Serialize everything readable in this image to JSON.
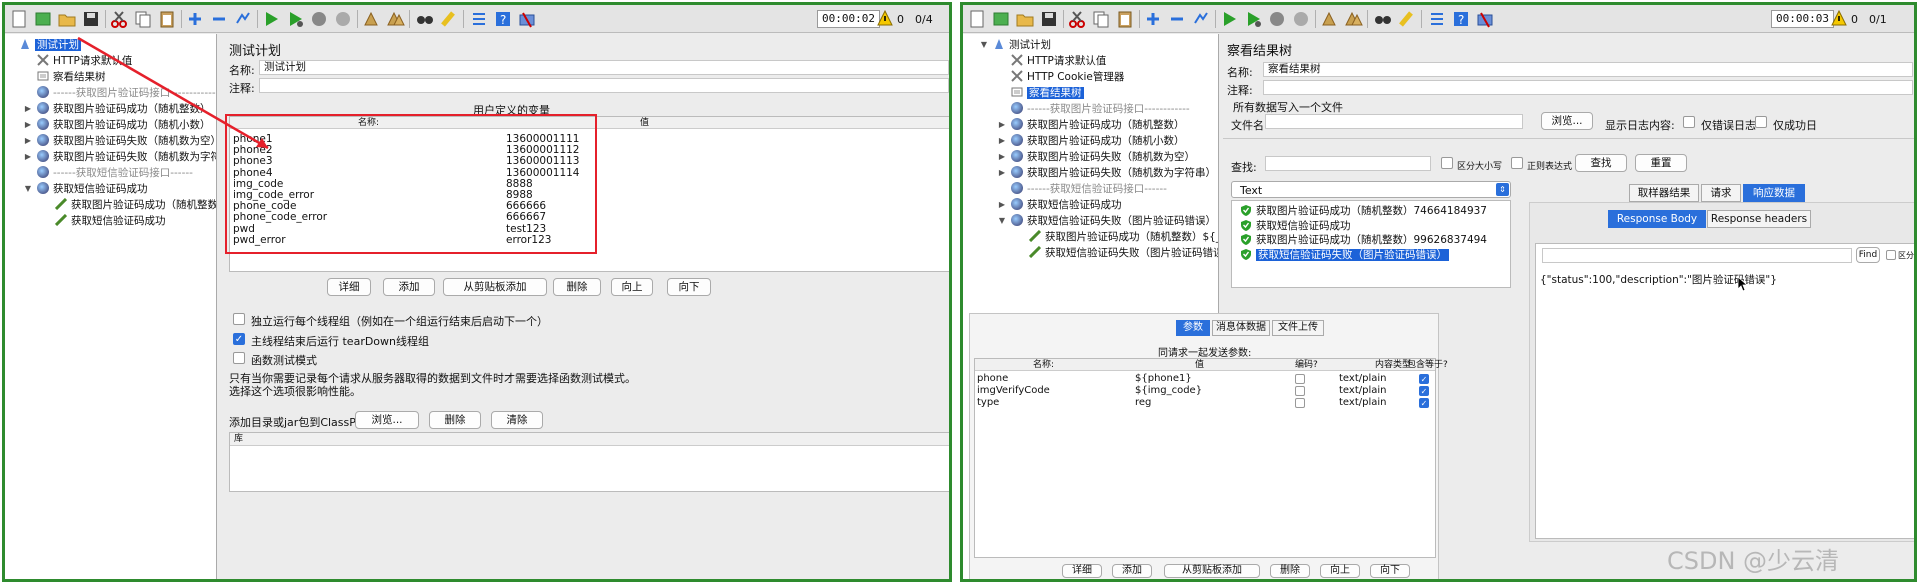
{
  "left": {
    "timer": "00:00:02",
    "warn_count": "0",
    "thread_count": "0/4",
    "tree": [
      {
        "label": "测试计划",
        "kind": "plan",
        "selected": true,
        "depth": 0
      },
      {
        "label": "HTTP请求默认值",
        "kind": "config",
        "depth": 1
      },
      {
        "label": "察看结果树",
        "kind": "listener",
        "depth": 1
      },
      {
        "label": "------获取图片验证码接口------------",
        "kind": "disabled",
        "depth": 1
      },
      {
        "label": "获取图片验证码成功（随机整数）",
        "kind": "group",
        "depth": 1,
        "toggle": "▶"
      },
      {
        "label": "获取图片验证码成功（随机小数）",
        "kind": "group",
        "depth": 1,
        "toggle": "▶"
      },
      {
        "label": "获取图片验证码失败（随机数为空）",
        "kind": "group",
        "depth": 1,
        "toggle": "▶"
      },
      {
        "label": "获取图片验证码失败（随机数为字符串）",
        "kind": "group",
        "depth": 1,
        "toggle": "▶"
      },
      {
        "label": "------获取短信验证码接口------",
        "kind": "disabled",
        "depth": 1
      },
      {
        "label": "获取短信验证码成功",
        "kind": "group",
        "depth": 1,
        "toggle": "▼"
      },
      {
        "label": "获取图片验证码成功（随机整数）${__Ra",
        "kind": "sampler",
        "depth": 2
      },
      {
        "label": "获取短信验证码成功",
        "kind": "sampler",
        "depth": 2
      }
    ],
    "panel_title": "测试计划",
    "name_label": "名称:",
    "name_value": "测试计划",
    "comment_label": "注释:",
    "comment_value": "",
    "udv_title": "用户定义的变量",
    "col_name": "名称:",
    "col_value": "值",
    "variables": [
      {
        "name": "phone1",
        "value": "13600001111"
      },
      {
        "name": "phone2",
        "value": "13600001112"
      },
      {
        "name": "phone3",
        "value": "13600001113"
      },
      {
        "name": "phone4",
        "value": "13600001114"
      },
      {
        "name": "img_code",
        "value": "8888"
      },
      {
        "name": "img_code_error",
        "value": "8988"
      },
      {
        "name": "phone_code",
        "value": "666666"
      },
      {
        "name": "phone_code_error",
        "value": "666667"
      },
      {
        "name": "pwd",
        "value": "test123"
      },
      {
        "name": "pwd_error",
        "value": "error123"
      }
    ],
    "buttons": [
      "详细",
      "添加",
      "从剪贴板添加",
      "删除",
      "向上",
      "向下"
    ],
    "opt1": "独立运行每个线程组（例如在一个组运行结束后启动下一个）",
    "opt1_checked": false,
    "opt2": "主线程结束后运行 tearDown线程组",
    "opt2_checked": true,
    "opt3": "函数测试模式",
    "opt3_checked": false,
    "note1": "只有当你需要记录每个请求从服务器取得的数据到文件时才需要选择函数测试模式。",
    "note2": "选择这个选项很影响性能。",
    "classpath_label": "添加目录或jar包到ClassPath",
    "cp_browse": "浏览...",
    "cp_delete": "删除",
    "cp_clear": "清除",
    "lib_header": "库"
  },
  "right": {
    "timer": "00:00:03",
    "warn_count": "0",
    "thread_count": "0/1",
    "tree": [
      {
        "label": "测试计划",
        "kind": "plan",
        "depth": 0,
        "toggle": "▼"
      },
      {
        "label": "HTTP请求默认值",
        "kind": "config",
        "depth": 1
      },
      {
        "label": "HTTP Cookie管理器",
        "kind": "config",
        "depth": 1
      },
      {
        "label": "察看结果树",
        "kind": "listener",
        "depth": 1,
        "selected": true
      },
      {
        "label": "------获取图片验证码接口------------",
        "kind": "disabled",
        "depth": 1
      },
      {
        "label": "获取图片验证码成功（随机整数）",
        "kind": "group",
        "depth": 1,
        "toggle": "▶"
      },
      {
        "label": "获取图片验证码成功（随机小数）",
        "kind": "group",
        "depth": 1,
        "toggle": "▶"
      },
      {
        "label": "获取图片验证码失败（随机数为空）",
        "kind": "group",
        "depth": 1,
        "toggle": "▶"
      },
      {
        "label": "获取图片验证码失败（随机数为字符串）",
        "kind": "group",
        "depth": 1,
        "toggle": "▶"
      },
      {
        "label": "------获取短信验证码接口------",
        "kind": "disabled",
        "depth": 1
      },
      {
        "label": "获取短信验证码成功",
        "kind": "group",
        "depth": 1,
        "toggle": "▶"
      },
      {
        "label": "获取短信验证码失败（图片验证码错误）",
        "kind": "group",
        "depth": 1,
        "toggle": "▼"
      },
      {
        "label": "获取图片验证码成功（随机整数）${__Ra",
        "kind": "sampler",
        "depth": 2
      },
      {
        "label": "获取短信验证码失败（图片验证码错误）",
        "kind": "sampler",
        "depth": 2
      }
    ],
    "panel_title": "察看结果树",
    "name_label": "名称:",
    "name_value": "察看结果树",
    "comment_label": "注释:",
    "all_data": "所有数据写入一个文件",
    "filename_label": "文件名",
    "browse": "浏览...",
    "log_label": "显示日志内容:",
    "errors_only": "仅错误日志",
    "success_only": "仅成功日",
    "search_label": "查找:",
    "case": "区分大小写",
    "regex": "正则表达式",
    "find_btn": "查找",
    "reset_btn": "重置",
    "render_select": "Text",
    "results": [
      {
        "label": "获取图片验证码成功（随机整数）74664184937",
        "selected": false
      },
      {
        "label": "获取短信验证码成功",
        "selected": false
      },
      {
        "label": "获取图片验证码成功（随机整数）99626837494",
        "selected": false
      },
      {
        "label": "获取短信验证码失败（图片验证码错误）",
        "selected": true
      }
    ],
    "result_tabs": [
      "取样器结果",
      "请求",
      "响应数据"
    ],
    "body_tabs": [
      "Response Body",
      "Response headers"
    ],
    "find_small": "Find",
    "case_small": "区分大小写",
    "response_body": "{\"status\":100,\"description\":\"图片验证码错误\"}",
    "req_tabs": [
      "参数",
      "消息体数据",
      "文件上传"
    ],
    "req_title": "同请求一起发送参数:",
    "req_cols": [
      "名称:",
      "值",
      "编码?",
      "内容类型",
      "包含等于?"
    ],
    "req_params": [
      {
        "name": "phone",
        "value": "${phone1}",
        "encode": false,
        "type": "text/plain",
        "include": true
      },
      {
        "name": "imgVerifyCode",
        "value": "${img_code}",
        "encode": false,
        "type": "text/plain",
        "include": true
      },
      {
        "name": "type",
        "value": "reg",
        "encode": false,
        "type": "text/plain",
        "include": true
      }
    ],
    "req_buttons": [
      "详细",
      "添加",
      "从剪贴板添加",
      "删除",
      "向上",
      "向下"
    ]
  },
  "watermark": "CSDN @少云清",
  "colors": {
    "border": "#2e8b2e",
    "highlight": "#e5202b",
    "selection": "#1c62d8",
    "accent": "#2a6fdb"
  }
}
